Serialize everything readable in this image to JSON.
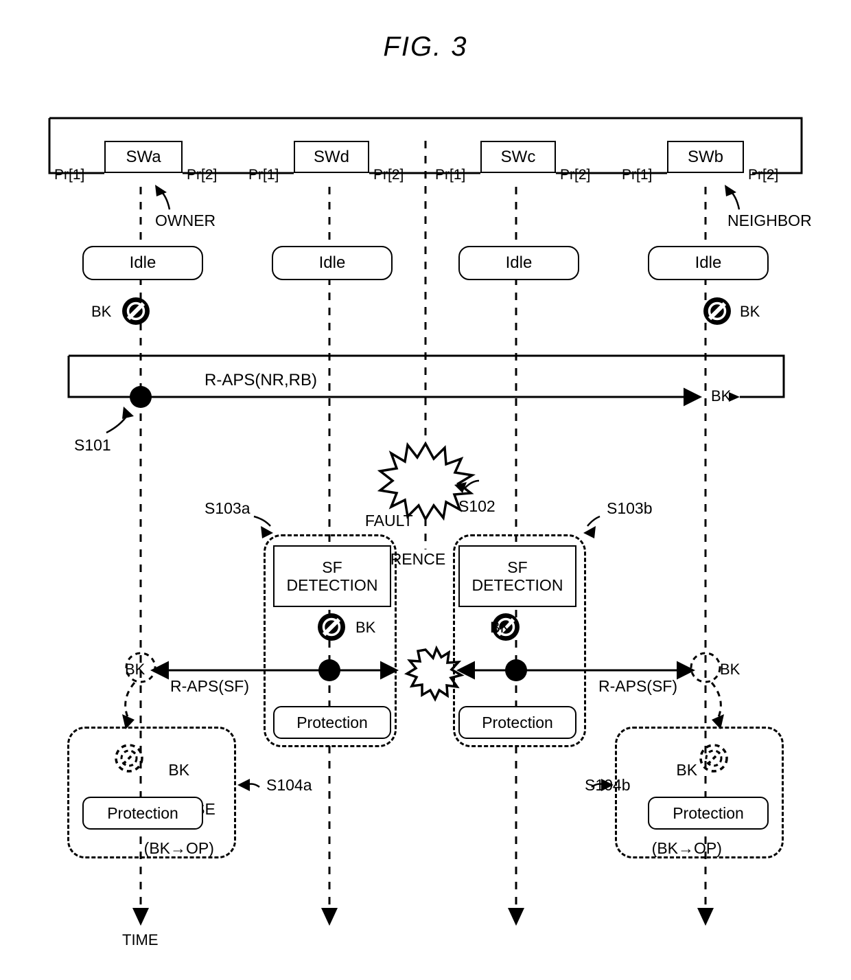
{
  "figure": {
    "title": "FIG.  3",
    "time_axis_label": "TIME"
  },
  "ring": {
    "nodes": [
      {
        "id": "swa",
        "name": "SWa",
        "port_left": "Pr[1]",
        "port_right": "Pr[2]",
        "role": "OWNER"
      },
      {
        "id": "swd",
        "name": "SWd",
        "port_left": "Pr[1]",
        "port_right": "Pr[2]",
        "role": ""
      },
      {
        "id": "swc",
        "name": "SWc",
        "port_left": "Pr[1]",
        "port_right": "Pr[2]",
        "role": ""
      },
      {
        "id": "swb",
        "name": "SWb",
        "port_left": "Pr[1]",
        "port_right": "Pr[2]",
        "role": "NEIGHBOR"
      }
    ],
    "owner_label": "OWNER",
    "neighbor_label": "NEIGHBOR"
  },
  "states": {
    "idle": "Idle",
    "protection": "Protection",
    "sf_detection": "SF\nDETECTION",
    "sf_detection_line1": "SF",
    "sf_detection_line2": "DETECTION",
    "bk_release_line1": "BK",
    "bk_release_line2": "RELEASE",
    "bk_release_line3": "(BK→OP)"
  },
  "labels": {
    "bk": "BK",
    "raps_nr_rb": "R-APS(NR,RB)",
    "raps_sf": "R-APS(SF)",
    "fault_line1": "FAULT",
    "fault_line2": "OCCURRENCE"
  },
  "steps": {
    "s101": "S101",
    "s102": "S102",
    "s103a": "S103a",
    "s103b": "S103b",
    "s104a": "S104a",
    "s104b": "S104b"
  },
  "colors": {
    "stroke": "#000000",
    "fill": "#ffffff"
  }
}
